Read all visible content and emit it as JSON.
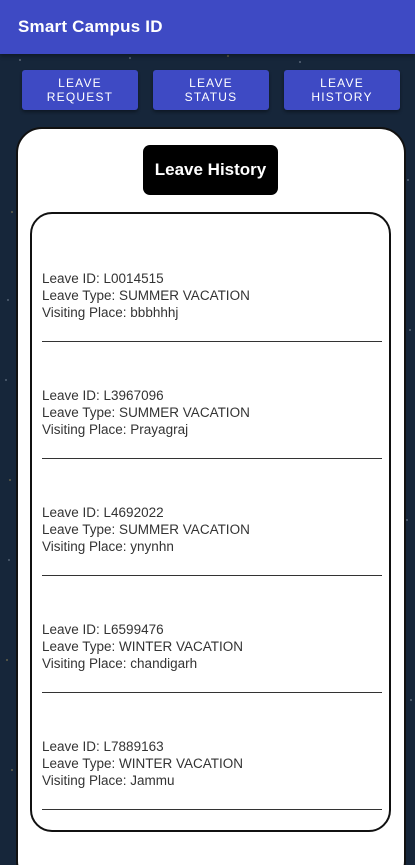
{
  "app": {
    "title": "Smart Campus ID"
  },
  "nav": {
    "buttons": [
      {
        "label": "LEAVE\nREQUEST"
      },
      {
        "label": "LEAVE\nSTATUS"
      },
      {
        "label": "LEAVE\nHISTORY"
      }
    ]
  },
  "history": {
    "heading": "Leave History",
    "entries": [
      {
        "id": "Leave ID: L0014515",
        "type": "Leave Type: SUMMER VACATION",
        "place": "Visiting Place: bbbhhhj"
      },
      {
        "id": "Leave ID: L3967096",
        "type": "Leave Type: SUMMER VACATION",
        "place": "Visiting Place: Prayagraj"
      },
      {
        "id": "Leave ID: L4692022",
        "type": "Leave Type: SUMMER VACATION",
        "place": "Visiting Place: ynynhn"
      },
      {
        "id": "Leave ID: L6599476",
        "type": "Leave Type: WINTER VACATION",
        "place": "Visiting Place: chandigarh"
      },
      {
        "id": "Leave ID: L7889163",
        "type": "Leave Type: WINTER VACATION",
        "place": "Visiting Place: Jammu"
      }
    ]
  }
}
